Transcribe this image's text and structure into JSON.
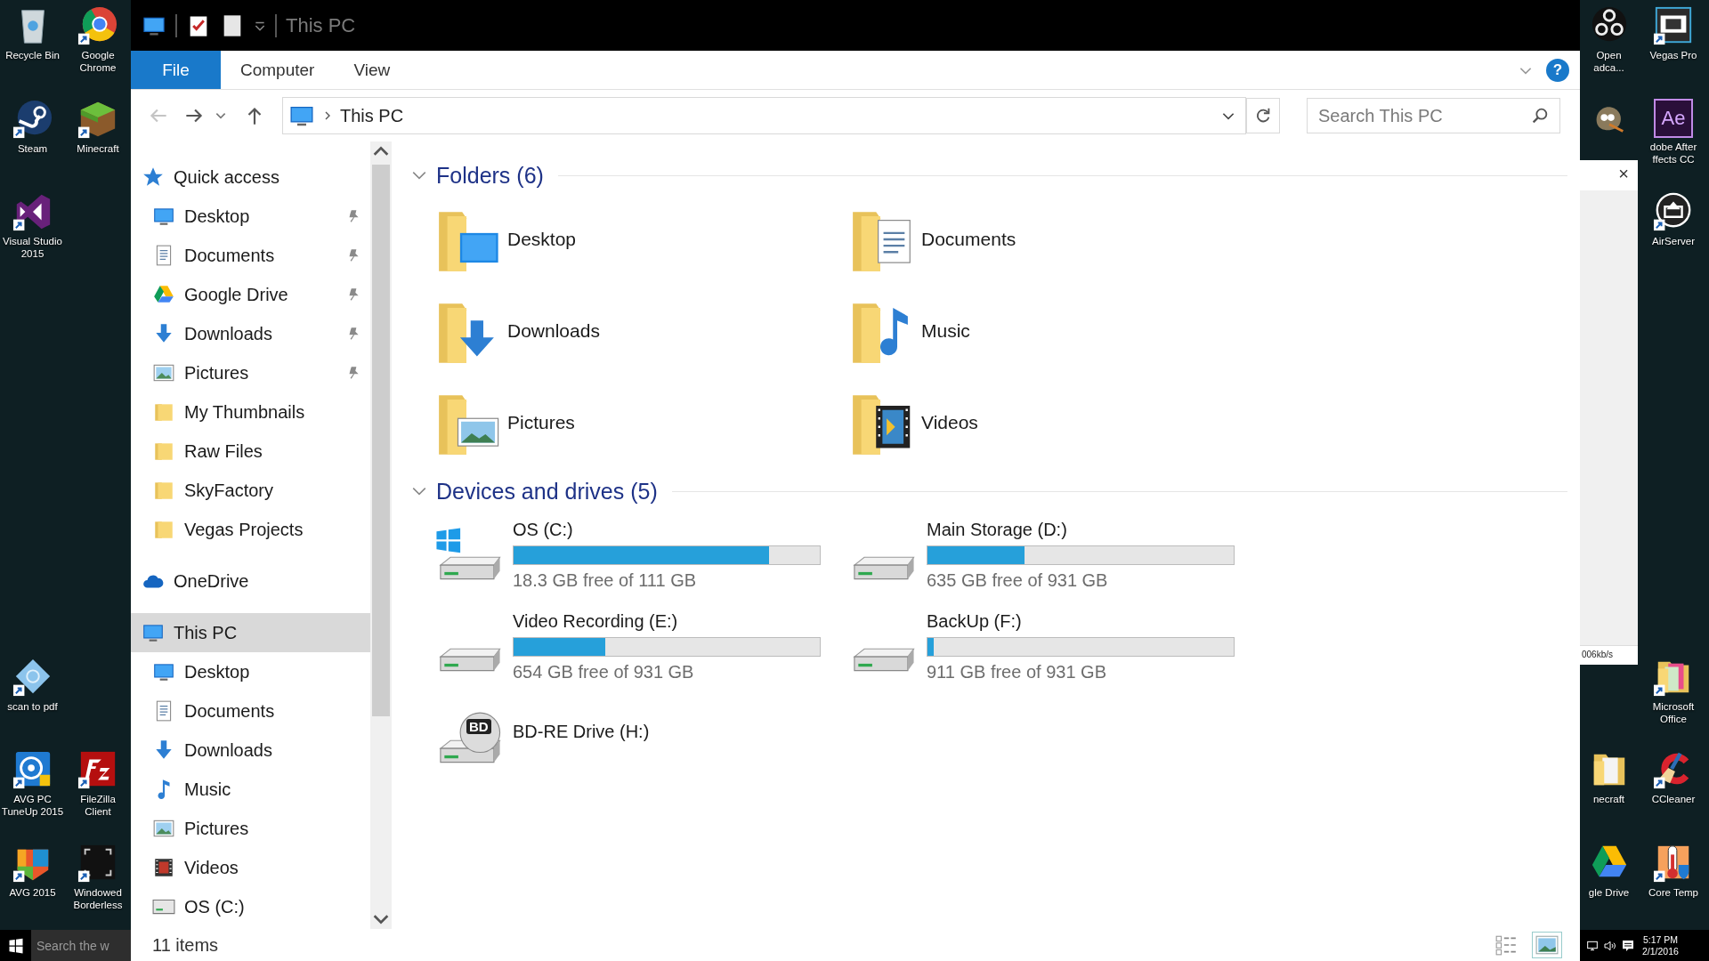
{
  "window": {
    "title": "This PC"
  },
  "ribbon": {
    "tabs": [
      {
        "label": "File",
        "selected": true
      },
      {
        "label": "Computer",
        "selected": false
      },
      {
        "label": "View",
        "selected": false
      }
    ],
    "help": "?"
  },
  "address": {
    "path": "This PC",
    "search_placeholder": "Search This PC"
  },
  "navigation": [
    {
      "label": "Quick access",
      "selected": false,
      "children": [
        {
          "label": "Desktop",
          "pinned": true,
          "selected": false
        },
        {
          "label": "Documents",
          "pinned": true,
          "selected": false
        },
        {
          "label": "Google Drive",
          "pinned": true,
          "selected": false
        },
        {
          "label": "Downloads",
          "pinned": true,
          "selected": false
        },
        {
          "label": "Pictures",
          "pinned": true,
          "selected": false
        },
        {
          "label": "My Thumbnails",
          "pinned": false,
          "selected": false
        },
        {
          "label": "Raw Files",
          "pinned": false,
          "selected": false
        },
        {
          "label": "SkyFactory",
          "pinned": false,
          "selected": false
        },
        {
          "label": "Vegas Projects",
          "pinned": false,
          "selected": false
        }
      ]
    },
    {
      "label": "OneDrive",
      "selected": false
    },
    {
      "label": "This PC",
      "selected": true,
      "children": [
        {
          "label": "Desktop",
          "pinned": false,
          "selected": false
        },
        {
          "label": "Documents",
          "pinned": false,
          "selected": false
        },
        {
          "label": "Downloads",
          "pinned": false,
          "selected": false
        },
        {
          "label": "Music",
          "pinned": false,
          "selected": false
        },
        {
          "label": "Pictures",
          "pinned": false,
          "selected": false
        },
        {
          "label": "Videos",
          "pinned": false,
          "selected": false
        },
        {
          "label": "OS (C:)",
          "pinned": false,
          "selected": false
        }
      ]
    }
  ],
  "groups": [
    {
      "title": "Folders (6)",
      "expanded": true,
      "kind": "folders",
      "items": [
        {
          "name": "Desktop"
        },
        {
          "name": "Documents"
        },
        {
          "name": "Downloads"
        },
        {
          "name": "Music"
        },
        {
          "name": "Pictures"
        },
        {
          "name": "Videos"
        }
      ]
    },
    {
      "title": "Devices and drives (5)",
      "expanded": true,
      "kind": "drives",
      "items": [
        {
          "kind": "disk",
          "name": "OS (C:)",
          "level": 0.835,
          "free": "18.3 GB free of 111 GB"
        },
        {
          "kind": "disk",
          "name": "Main Storage (D:)",
          "level": 0.318,
          "free": "635 GB free of 931 GB"
        },
        {
          "kind": "disk",
          "name": "Video Recording (E:)",
          "level": 0.298,
          "free": "654 GB free of 931 GB"
        },
        {
          "kind": "disk",
          "name": "BackUp (F:)",
          "level": 0.021,
          "free": "911 GB free of 931 GB"
        },
        {
          "kind": "optical",
          "name": "BD-RE Drive (H:)",
          "badge": "BD"
        }
      ]
    }
  ],
  "status_bar": {
    "count": "11 items"
  },
  "desktop_left": [
    {
      "label": "Recycle Bin"
    },
    {
      "label": "Google Chrome"
    },
    {
      "label": "Steam"
    },
    {
      "label": "Minecraft"
    },
    {
      "label": "Visual Studio 2015"
    },
    {
      "label": "scan to pdf"
    },
    {
      "label": "AVG PC TuneUp 2015"
    },
    {
      "label": "FileZilla Client"
    },
    {
      "label": "AVG 2015"
    },
    {
      "label": "Windowed Borderless"
    }
  ],
  "desktop_right": [
    {
      "label": "Open adca..."
    },
    {
      "label": "Vegas Pro"
    },
    {
      "label": "dobe After ffects CC",
      "logo": "Ae"
    },
    {
      "label": "AirServer"
    },
    {
      "label": "Microsoft Office"
    },
    {
      "label": "necraft"
    },
    {
      "label": "CCleaner"
    },
    {
      "label": "gle Drive"
    },
    {
      "label": "Core Temp"
    }
  ],
  "side_window": {
    "close": "×",
    "speed": "006kb/s"
  },
  "taskbar": {
    "search_placeholder": "Search the w",
    "time": "5:17 PM",
    "date": "2/1/2016"
  }
}
